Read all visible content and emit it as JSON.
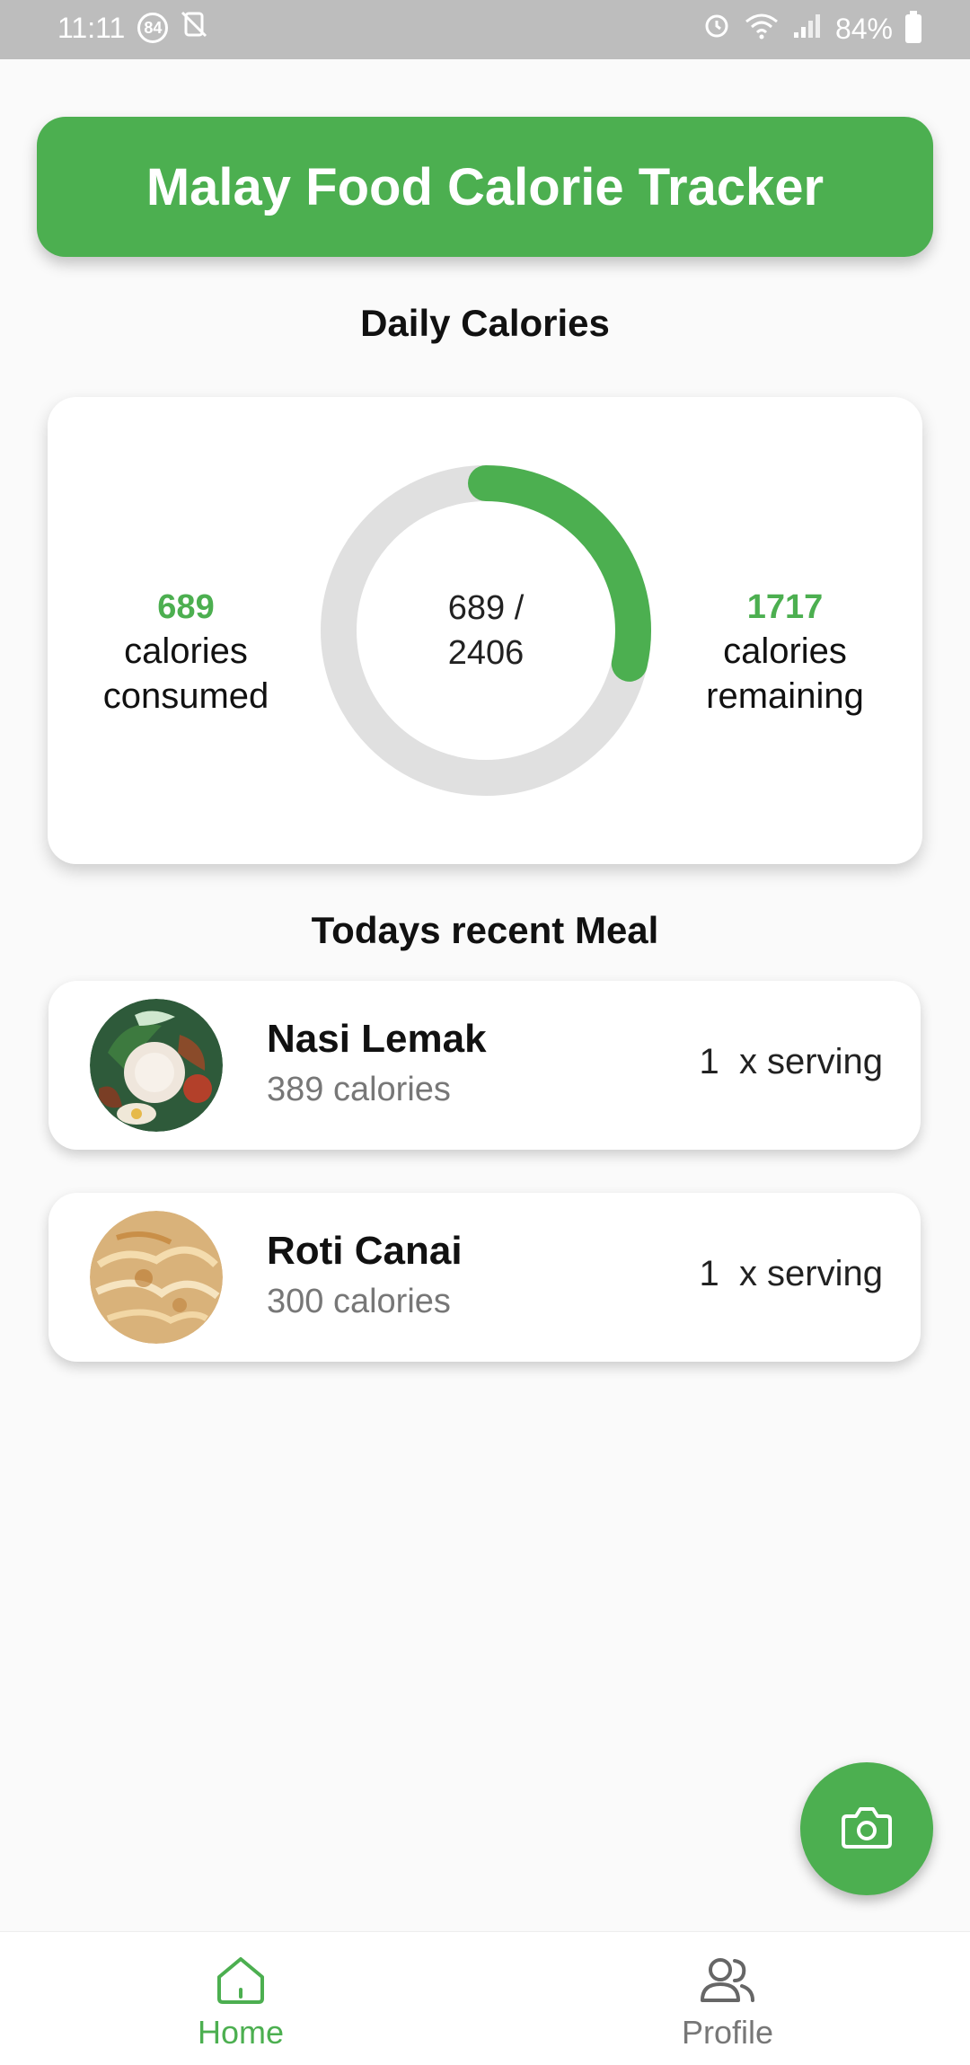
{
  "status_bar": {
    "time": "11:11",
    "notification_badge": "84",
    "battery": "84%"
  },
  "header": {
    "title": "Malay Food Calorie Tracker"
  },
  "daily": {
    "section_title": "Daily Calories",
    "consumed_value": "689",
    "consumed_label_line1": "calories",
    "consumed_label_line2": "consumed",
    "remaining_value": "1717",
    "remaining_label_line1": "calories",
    "remaining_label_line2": "remaining",
    "ring_line1": "689 /",
    "ring_line2": "2406",
    "progress_fraction": 0.286,
    "goal": 2406,
    "consumed": 689
  },
  "recent": {
    "section_title": "Todays recent Meal",
    "meals": [
      {
        "name": "Nasi Lemak",
        "calories": "389 calories",
        "quantity": "1",
        "serving": "x serving"
      },
      {
        "name": "Roti Canai",
        "calories": "300 calories",
        "quantity": "1",
        "serving": "x serving"
      }
    ]
  },
  "fab": {
    "icon": "camera-icon"
  },
  "nav": {
    "items": [
      {
        "label": "Home",
        "icon": "home-icon",
        "active": true
      },
      {
        "label": "Profile",
        "icon": "profile-icon",
        "active": false
      }
    ]
  },
  "colors": {
    "accent": "#4caf50",
    "ring_track": "#e0e0e0",
    "inactive_nav": "#777777"
  }
}
